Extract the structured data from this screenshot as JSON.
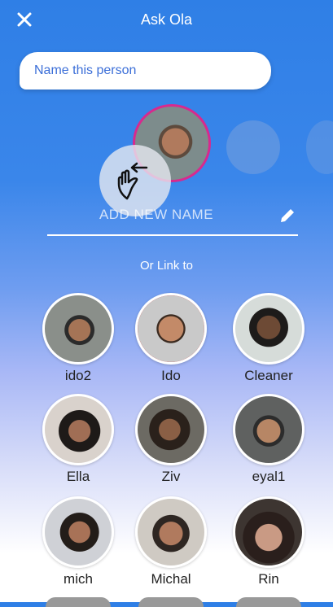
{
  "header": {
    "title": "Ask Ola",
    "close_icon": "close-icon"
  },
  "name_prompt": {
    "text": "Name this person"
  },
  "add_name": {
    "placeholder": "ADD NEW NAME",
    "edit_icon": "pencil-icon"
  },
  "swipe_hint": {
    "icon": "swipe-hand-icon"
  },
  "link_section": {
    "label": "Or Link to"
  },
  "people": [
    {
      "name": "ido2"
    },
    {
      "name": "Ido"
    },
    {
      "name": "Cleaner"
    },
    {
      "name": "Ella"
    },
    {
      "name": "Ziv"
    },
    {
      "name": "eyal1"
    },
    {
      "name": "mich"
    },
    {
      "name": "Michal"
    },
    {
      "name": "Rin"
    }
  ],
  "colors": {
    "accent": "#d8298e",
    "background_top": "#2f7fe6",
    "prompt_text": "#3c6fd8"
  }
}
